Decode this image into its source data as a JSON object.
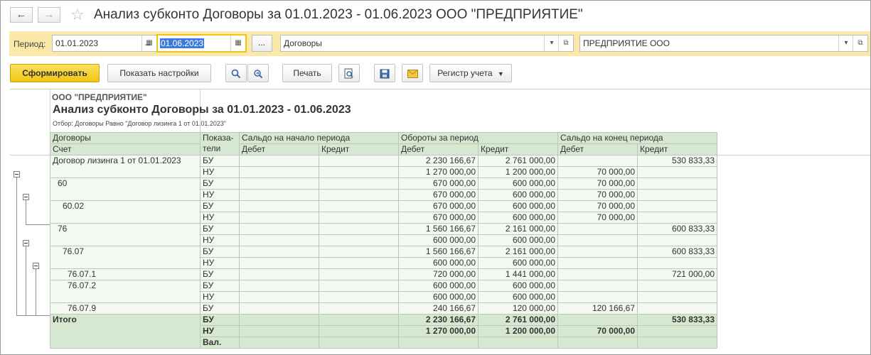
{
  "window": {
    "title": "Анализ субконто Договоры за 01.01.2023 - 01.06.2023 ООО \"ПРЕДПРИЯТИЕ\"",
    "back_icon": "arrow-left-icon",
    "forward_icon": "arrow-right-icon",
    "favorite_icon": "star-icon"
  },
  "filter": {
    "period_label": "Период:",
    "date_from": "01.01.2023",
    "dash": "–",
    "date_to": "01.06.2023",
    "ellipsis": "...",
    "subconto": "Договоры",
    "organization": "ПРЕДПРИЯТИЕ ООО",
    "calendar_icon": "calendar-icon",
    "open_icon": "open-icon"
  },
  "toolbar": {
    "generate": "Сформировать",
    "settings": "Показать настройки",
    "print": "Печать",
    "register": "Регистр учета"
  },
  "report": {
    "org": "ООО \"ПРЕДПРИЯТИЕ\"",
    "title": "Анализ субконто Договоры за 01.01.2023 - 01.06.2023",
    "filter_text": "Отбор: Договоры Равно \"Договор лизинга 1 от 01.01.2023\"",
    "headers": {
      "contracts": "Договоры",
      "account": "Счет",
      "indicators": "Показа-\nтели",
      "opening": "Сальдо на начало периода",
      "turnover": "Обороты за период",
      "closing": "Сальдо на конец периода",
      "debit": "Дебет",
      "credit": "Кредит"
    },
    "rows": [
      {
        "name": "Договор лизинга 1 от 01.01.2023",
        "indent": 0,
        "lines": [
          {
            "ind": "БУ",
            "od": "",
            "oc": "",
            "td": "2 230 166,67",
            "tc": "2 761 000,00",
            "cd": "",
            "cc": "530 833,33"
          },
          {
            "ind": "НУ",
            "od": "",
            "oc": "",
            "td": "1 270 000,00",
            "tc": "1 200 000,00",
            "cd": "70 000,00",
            "cc": ""
          }
        ]
      },
      {
        "name": "60",
        "indent": 1,
        "lines": [
          {
            "ind": "БУ",
            "od": "",
            "oc": "",
            "td": "670 000,00",
            "tc": "600 000,00",
            "cd": "70 000,00",
            "cc": ""
          },
          {
            "ind": "НУ",
            "od": "",
            "oc": "",
            "td": "670 000,00",
            "tc": "600 000,00",
            "cd": "70 000,00",
            "cc": ""
          }
        ]
      },
      {
        "name": "60.02",
        "indent": 2,
        "lines": [
          {
            "ind": "БУ",
            "od": "",
            "oc": "",
            "td": "670 000,00",
            "tc": "600 000,00",
            "cd": "70 000,00",
            "cc": ""
          },
          {
            "ind": "НУ",
            "od": "",
            "oc": "",
            "td": "670 000,00",
            "tc": "600 000,00",
            "cd": "70 000,00",
            "cc": ""
          }
        ]
      },
      {
        "name": "76",
        "indent": 1,
        "lines": [
          {
            "ind": "БУ",
            "od": "",
            "oc": "",
            "td": "1 560 166,67",
            "tc": "2 161 000,00",
            "cd": "",
            "cc": "600 833,33"
          },
          {
            "ind": "НУ",
            "od": "",
            "oc": "",
            "td": "600 000,00",
            "tc": "600 000,00",
            "cd": "",
            "cc": ""
          }
        ]
      },
      {
        "name": "76.07",
        "indent": 2,
        "lines": [
          {
            "ind": "БУ",
            "od": "",
            "oc": "",
            "td": "1 560 166,67",
            "tc": "2 161 000,00",
            "cd": "",
            "cc": "600 833,33"
          },
          {
            "ind": "НУ",
            "od": "",
            "oc": "",
            "td": "600 000,00",
            "tc": "600 000,00",
            "cd": "",
            "cc": ""
          }
        ]
      },
      {
        "name": "76.07.1",
        "indent": 3,
        "lines": [
          {
            "ind": "БУ",
            "od": "",
            "oc": "",
            "td": "720 000,00",
            "tc": "1 441 000,00",
            "cd": "",
            "cc": "721 000,00"
          }
        ]
      },
      {
        "name": "76.07.2",
        "indent": 3,
        "lines": [
          {
            "ind": "БУ",
            "od": "",
            "oc": "",
            "td": "600 000,00",
            "tc": "600 000,00",
            "cd": "",
            "cc": ""
          },
          {
            "ind": "НУ",
            "od": "",
            "oc": "",
            "td": "600 000,00",
            "tc": "600 000,00",
            "cd": "",
            "cc": ""
          }
        ]
      },
      {
        "name": "76.07.9",
        "indent": 3,
        "lines": [
          {
            "ind": "БУ",
            "od": "",
            "oc": "",
            "td": "240 166,67",
            "tc": "120 000,00",
            "cd": "120 166,67",
            "cc": ""
          }
        ]
      }
    ],
    "total": {
      "name": "Итого",
      "lines": [
        {
          "ind": "БУ",
          "od": "",
          "oc": "",
          "td": "2 230 166,67",
          "tc": "2 761 000,00",
          "cd": "",
          "cc": "530 833,33"
        },
        {
          "ind": "НУ",
          "od": "",
          "oc": "",
          "td": "1 270 000,00",
          "tc": "1 200 000,00",
          "cd": "70 000,00",
          "cc": ""
        },
        {
          "ind": "Вал.",
          "od": "",
          "oc": "",
          "td": "",
          "tc": "",
          "cd": "",
          "cc": ""
        }
      ]
    }
  }
}
